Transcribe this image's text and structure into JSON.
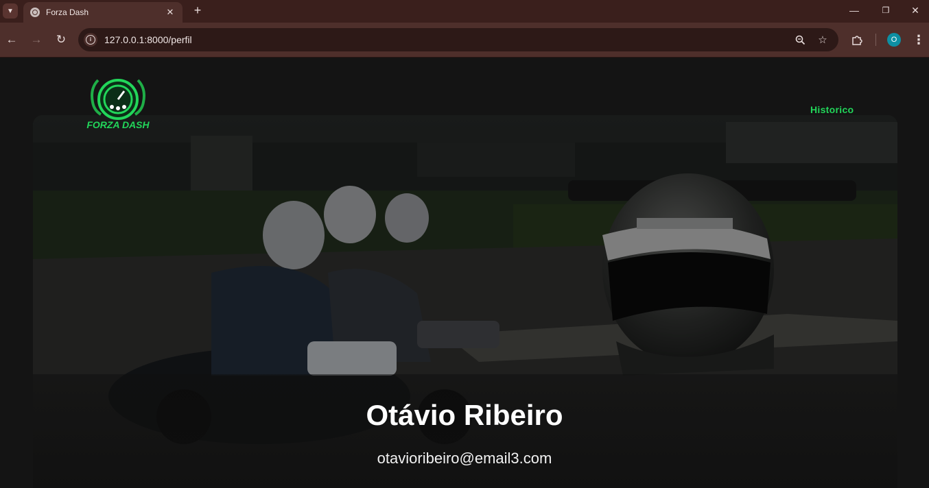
{
  "browser": {
    "tab_title": "Forza Dash",
    "url": "127.0.0.1:8000/perfil",
    "profile_initial": "O",
    "icons": {
      "tab_search": "chevron-down-icon",
      "favicon": "globe-icon",
      "tab_close": "close-icon",
      "new_tab": "plus-icon",
      "minimize": "minimize-icon",
      "restore": "restore-icon",
      "close_window": "close-icon",
      "back": "arrow-left-icon",
      "forward": "arrow-right-icon",
      "reload": "reload-icon",
      "site_info": "info-icon",
      "zoom": "zoom-icon",
      "bookmark": "star-icon",
      "extensions": "puzzle-icon",
      "menu": "kebab-menu-icon"
    }
  },
  "site": {
    "logo_text": "FORZA DASH",
    "nav": {
      "historico": "Historico"
    },
    "accent_color": "#22d65a"
  },
  "profile": {
    "name": "Otávio Ribeiro",
    "email": "otavioribeiro@email3.com"
  }
}
